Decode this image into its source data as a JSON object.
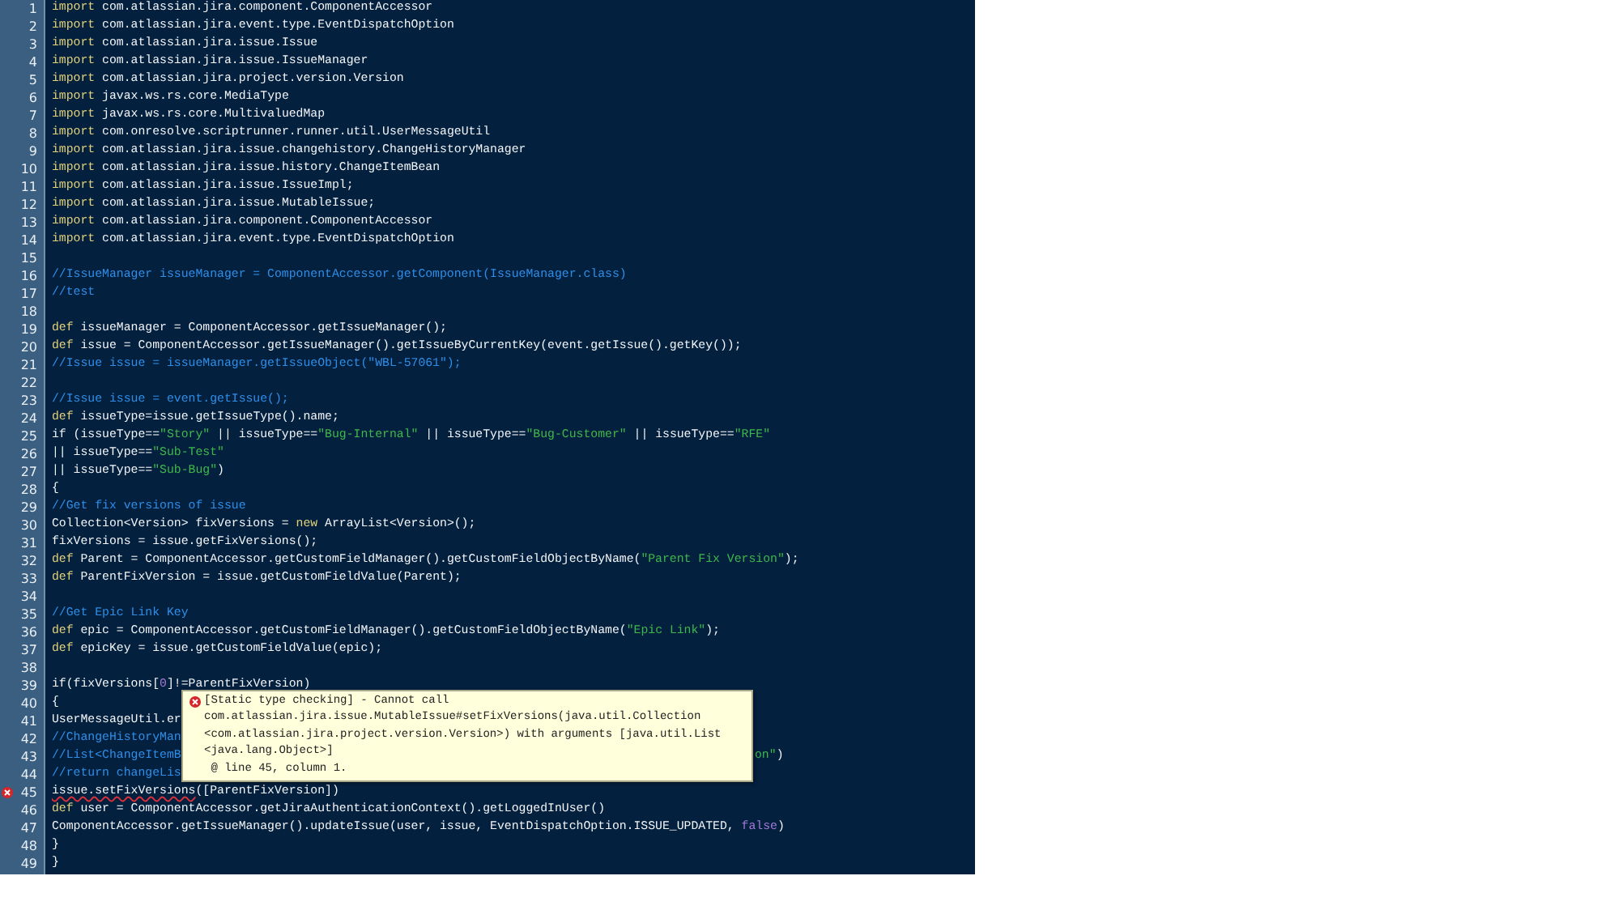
{
  "editor": {
    "lines": [
      {
        "number": "1",
        "error": false,
        "segments": [
          {
            "kind": "keyword",
            "text": "import"
          },
          {
            "kind": "plain",
            "text": " com.atlassian.jira.component.ComponentAccessor"
          }
        ]
      },
      {
        "number": "2",
        "error": false,
        "segments": [
          {
            "kind": "keyword",
            "text": "import"
          },
          {
            "kind": "plain",
            "text": " com.atlassian.jira.event.type.EventDispatchOption"
          }
        ]
      },
      {
        "number": "3",
        "error": false,
        "segments": [
          {
            "kind": "keyword",
            "text": "import"
          },
          {
            "kind": "plain",
            "text": " com.atlassian.jira.issue.Issue"
          }
        ]
      },
      {
        "number": "4",
        "error": false,
        "segments": [
          {
            "kind": "keyword",
            "text": "import"
          },
          {
            "kind": "plain",
            "text": " com.atlassian.jira.issue.IssueManager"
          }
        ]
      },
      {
        "number": "5",
        "error": false,
        "segments": [
          {
            "kind": "keyword",
            "text": "import"
          },
          {
            "kind": "plain",
            "text": " com.atlassian.jira.project.version.Version"
          }
        ]
      },
      {
        "number": "6",
        "error": false,
        "segments": [
          {
            "kind": "keyword",
            "text": "import"
          },
          {
            "kind": "plain",
            "text": " javax.ws.rs.core.MediaType"
          }
        ]
      },
      {
        "number": "7",
        "error": false,
        "segments": [
          {
            "kind": "keyword",
            "text": "import"
          },
          {
            "kind": "plain",
            "text": " javax.ws.rs.core.MultivaluedMap"
          }
        ]
      },
      {
        "number": "8",
        "error": false,
        "segments": [
          {
            "kind": "keyword",
            "text": "import"
          },
          {
            "kind": "plain",
            "text": " com.onresolve.scriptrunner.runner.util.UserMessageUtil"
          }
        ]
      },
      {
        "number": "9",
        "error": false,
        "segments": [
          {
            "kind": "keyword",
            "text": "import"
          },
          {
            "kind": "plain",
            "text": " com.atlassian.jira.issue.changehistory.ChangeHistoryManager"
          }
        ]
      },
      {
        "number": "10",
        "error": false,
        "segments": [
          {
            "kind": "keyword",
            "text": "import"
          },
          {
            "kind": "plain",
            "text": " com.atlassian.jira.issue.history.ChangeItemBean"
          }
        ]
      },
      {
        "number": "11",
        "error": false,
        "segments": [
          {
            "kind": "keyword",
            "text": "import"
          },
          {
            "kind": "plain",
            "text": " com.atlassian.jira.issue.IssueImpl;"
          }
        ]
      },
      {
        "number": "12",
        "error": false,
        "segments": [
          {
            "kind": "keyword",
            "text": "import"
          },
          {
            "kind": "plain",
            "text": " com.atlassian.jira.issue.MutableIssue;"
          }
        ]
      },
      {
        "number": "13",
        "error": false,
        "segments": [
          {
            "kind": "keyword",
            "text": "import"
          },
          {
            "kind": "plain",
            "text": " com.atlassian.jira.component.ComponentAccessor"
          }
        ]
      },
      {
        "number": "14",
        "error": false,
        "segments": [
          {
            "kind": "keyword",
            "text": "import"
          },
          {
            "kind": "plain",
            "text": " com.atlassian.jira.event.type.EventDispatchOption"
          }
        ]
      },
      {
        "number": "15",
        "error": false
      },
      {
        "number": "16",
        "error": false,
        "segments": [
          {
            "kind": "comment",
            "text": "//IssueManager issueManager = ComponentAccessor.getComponent(IssueManager.class)"
          }
        ]
      },
      {
        "number": "17",
        "error": false,
        "segments": [
          {
            "kind": "comment",
            "text": "//test"
          }
        ]
      },
      {
        "number": "18",
        "error": false
      },
      {
        "number": "19",
        "error": false,
        "segments": [
          {
            "kind": "keyword",
            "text": "def"
          },
          {
            "kind": "plain",
            "text": " issueManager = ComponentAccessor.getIssueManager();"
          }
        ]
      },
      {
        "number": "20",
        "error": false,
        "segments": [
          {
            "kind": "keyword",
            "text": "def"
          },
          {
            "kind": "plain",
            "text": " issue = ComponentAccessor.getIssueManager().getIssueByCurrentKey(event.getIssue().getKey());"
          }
        ]
      },
      {
        "number": "21",
        "error": false,
        "segments": [
          {
            "kind": "comment",
            "text": "//Issue issue = issueManager.getIssueObject(\"WBL-57061\");"
          }
        ]
      },
      {
        "number": "22",
        "error": false
      },
      {
        "number": "23",
        "error": false,
        "segments": [
          {
            "kind": "comment",
            "text": "//Issue issue = event.getIssue();"
          }
        ]
      },
      {
        "number": "24",
        "error": false,
        "segments": [
          {
            "kind": "keyword",
            "text": "def"
          },
          {
            "kind": "plain",
            "text": " issueType=issue.getIssueType().name;"
          }
        ]
      },
      {
        "number": "25",
        "error": false,
        "segments": [
          {
            "kind": "plain",
            "text": "if (issueType=="
          },
          {
            "kind": "string",
            "text": "\"Story\""
          },
          {
            "kind": "plain",
            "text": " || issueType=="
          },
          {
            "kind": "string",
            "text": "\"Bug-Internal\""
          },
          {
            "kind": "plain",
            "text": " || issueType=="
          },
          {
            "kind": "string",
            "text": "\"Bug-Customer\""
          },
          {
            "kind": "plain",
            "text": " || issueType=="
          },
          {
            "kind": "string",
            "text": "\"RFE\""
          }
        ]
      },
      {
        "number": "26",
        "error": false,
        "segments": [
          {
            "kind": "plain",
            "text": "|| issueType=="
          },
          {
            "kind": "string",
            "text": "\"Sub-Test\""
          }
        ]
      },
      {
        "number": "27",
        "error": false,
        "segments": [
          {
            "kind": "plain",
            "text": "|| issueType=="
          },
          {
            "kind": "string",
            "text": "\"Sub-Bug\""
          },
          {
            "kind": "plain",
            "text": ")"
          }
        ]
      },
      {
        "number": "28",
        "error": false,
        "segments": [
          {
            "kind": "plain",
            "text": "{"
          }
        ]
      },
      {
        "number": "29",
        "error": false,
        "segments": [
          {
            "kind": "comment",
            "text": "//Get fix versions of issue"
          }
        ]
      },
      {
        "number": "30",
        "error": false,
        "segments": [
          {
            "kind": "plain",
            "text": "Collection<Version> fixVersions = "
          },
          {
            "kind": "keyword",
            "text": "new"
          },
          {
            "kind": "plain",
            "text": " ArrayList<Version>();"
          }
        ]
      },
      {
        "number": "31",
        "error": false,
        "segments": [
          {
            "kind": "plain",
            "text": "fixVersions = issue.getFixVersions();"
          }
        ]
      },
      {
        "number": "32",
        "error": false,
        "segments": [
          {
            "kind": "keyword",
            "text": "def"
          },
          {
            "kind": "plain",
            "text": " Parent = ComponentAccessor.getCustomFieldManager().getCustomFieldObjectByName("
          },
          {
            "kind": "string",
            "text": "\"Parent Fix Version\""
          },
          {
            "kind": "plain",
            "text": ");"
          }
        ]
      },
      {
        "number": "33",
        "error": false,
        "segments": [
          {
            "kind": "keyword",
            "text": "def"
          },
          {
            "kind": "plain",
            "text": " ParentFixVersion = issue.getCustomFieldValue(Parent);"
          }
        ]
      },
      {
        "number": "34",
        "error": false
      },
      {
        "number": "35",
        "error": false,
        "segments": [
          {
            "kind": "comment",
            "text": "//Get Epic Link Key"
          }
        ]
      },
      {
        "number": "36",
        "error": false,
        "segments": [
          {
            "kind": "keyword",
            "text": "def"
          },
          {
            "kind": "plain",
            "text": " epic = ComponentAccessor.getCustomFieldManager().getCustomFieldObjectByName("
          },
          {
            "kind": "string",
            "text": "\"Epic Link\""
          },
          {
            "kind": "plain",
            "text": ");"
          }
        ]
      },
      {
        "number": "37",
        "error": false,
        "segments": [
          {
            "kind": "keyword",
            "text": "def"
          },
          {
            "kind": "plain",
            "text": " epicKey = issue.getCustomFieldValue(epic);"
          }
        ]
      },
      {
        "number": "38",
        "error": false
      },
      {
        "number": "39",
        "error": false,
        "segments": [
          {
            "kind": "plain",
            "text": "if(fixVersions["
          },
          {
            "kind": "number",
            "text": "0"
          },
          {
            "kind": "plain",
            "text": "]!=ParentFixVersion)"
          }
        ]
      },
      {
        "number": "40",
        "error": false,
        "segments": [
          {
            "kind": "plain",
            "text": "{"
          }
        ]
      },
      {
        "number": "41",
        "error": false,
        "segments": [
          {
            "kind": "plain",
            "text": "UserMessageUtil.er"
          }
        ]
      },
      {
        "number": "42",
        "error": false,
        "segments": [
          {
            "kind": "comment",
            "text": "//ChangeHistoryMan"
          }
        ]
      },
      {
        "number": "43",
        "error": false,
        "segments": [
          {
            "kind": "comment",
            "text": "//List<ChangeItemB"
          }
        ],
        "tail": [
          {
            "kind": "string",
            "text": "on\""
          },
          {
            "kind": "plain",
            "text": ")"
          }
        ]
      },
      {
        "number": "44",
        "error": false,
        "segments": [
          {
            "kind": "comment",
            "text": "//return changeLis"
          }
        ]
      },
      {
        "number": "45",
        "error": true,
        "segments": [
          {
            "kind": "plain",
            "text": "issue.setFixVersions"
          },
          {
            "kind": "plain",
            "text": "([ParentFixVersion])"
          }
        ]
      },
      {
        "number": "46",
        "error": false,
        "segments": [
          {
            "kind": "keyword",
            "text": "def"
          },
          {
            "kind": "plain",
            "text": " user = ComponentAccessor.getJiraAuthenticationContext().getLoggedInUser()"
          }
        ]
      },
      {
        "number": "47",
        "error": false,
        "segments": [
          {
            "kind": "plain",
            "text": "ComponentAccessor.getIssueManager().updateIssue(user, issue, EventDispatchOption.ISSUE_UPDATED, "
          },
          {
            "kind": "number",
            "text": "false"
          },
          {
            "kind": "plain",
            "text": ")"
          }
        ]
      },
      {
        "number": "48",
        "error": false,
        "segments": [
          {
            "kind": "plain",
            "text": "}"
          }
        ]
      },
      {
        "number": "49",
        "error": false,
        "segments": [
          {
            "kind": "plain",
            "text": "}"
          }
        ]
      }
    ]
  },
  "tooltip": {
    "lines": [
      "[Static type checking] - Cannot call",
      "com.atlassian.jira.issue.MutableIssue#setFixVersions(java.util.Collection",
      "<com.atlassian.jira.project.version.Version>) with arguments [java.util.List",
      "<java.lang.Object>]",
      " @ line 45, column 1."
    ]
  }
}
